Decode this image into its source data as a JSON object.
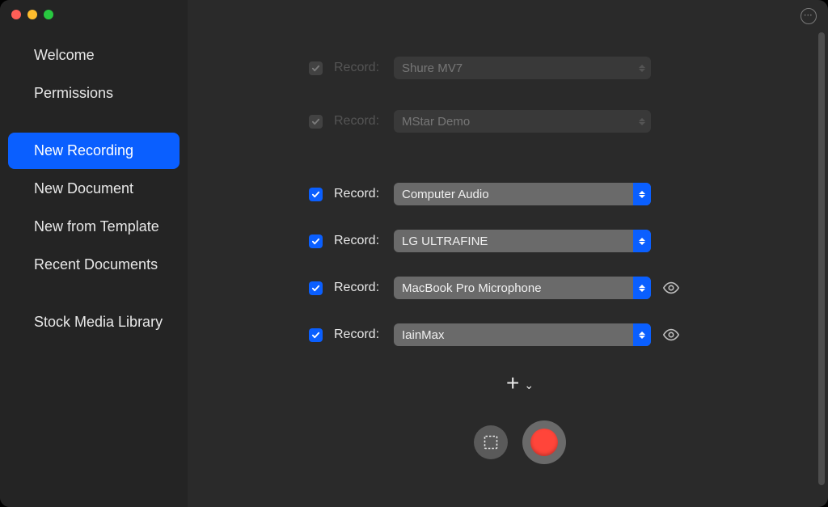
{
  "window": {
    "more_icon": "…"
  },
  "sidebar": {
    "groups": [
      {
        "items": [
          "Welcome",
          "Permissions"
        ]
      },
      {
        "items": [
          "New Recording",
          "New Document",
          "New from Template",
          "Recent Documents"
        ]
      },
      {
        "items": [
          "Stock Media Library"
        ]
      }
    ],
    "selected": "New Recording"
  },
  "labels": {
    "record": "Record:",
    "add": "+"
  },
  "sources": [
    {
      "checked": true,
      "enabled": false,
      "value": "Shure MV7",
      "eye": false
    },
    {
      "checked": true,
      "enabled": false,
      "value": "MStar Demo",
      "eye": false
    },
    {
      "checked": true,
      "enabled": true,
      "value": "Computer Audio",
      "eye": false
    },
    {
      "checked": true,
      "enabled": true,
      "value": "LG ULTRAFINE",
      "eye": false
    },
    {
      "checked": true,
      "enabled": true,
      "value": "MacBook Pro Microphone",
      "eye": true
    },
    {
      "checked": true,
      "enabled": true,
      "value": "IainMax",
      "eye": true
    }
  ],
  "colors": {
    "accent": "#0a5fff",
    "record": "#ff453a",
    "sidebar_bg": "#242424",
    "content_bg": "#2a2a2a"
  }
}
